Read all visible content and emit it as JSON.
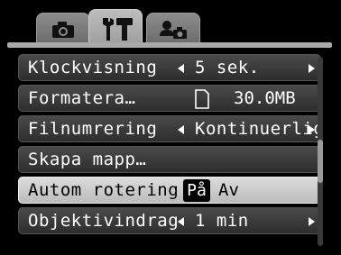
{
  "tabs": [
    {
      "name": "shooting",
      "icon": "camera-icon",
      "active": false
    },
    {
      "name": "setup",
      "icon": "tools-icon",
      "active": true
    },
    {
      "name": "my-settings",
      "icon": "person-camera-icon",
      "active": false
    }
  ],
  "menu": {
    "items": [
      {
        "label": "Klockvisning",
        "value": "5 sek."
      },
      {
        "label": "Formatera…",
        "value": "30.0MB"
      },
      {
        "label": "Filnumrering",
        "value": "Kontinuerlig"
      },
      {
        "label": "Skapa mapp…"
      },
      {
        "label": "Autom rotering",
        "value_on": "På",
        "value_off": "Av"
      },
      {
        "label": "Objektivindrag",
        "value": "1 min"
      }
    ]
  },
  "scrollbar": {
    "position_fraction": 0.45
  }
}
